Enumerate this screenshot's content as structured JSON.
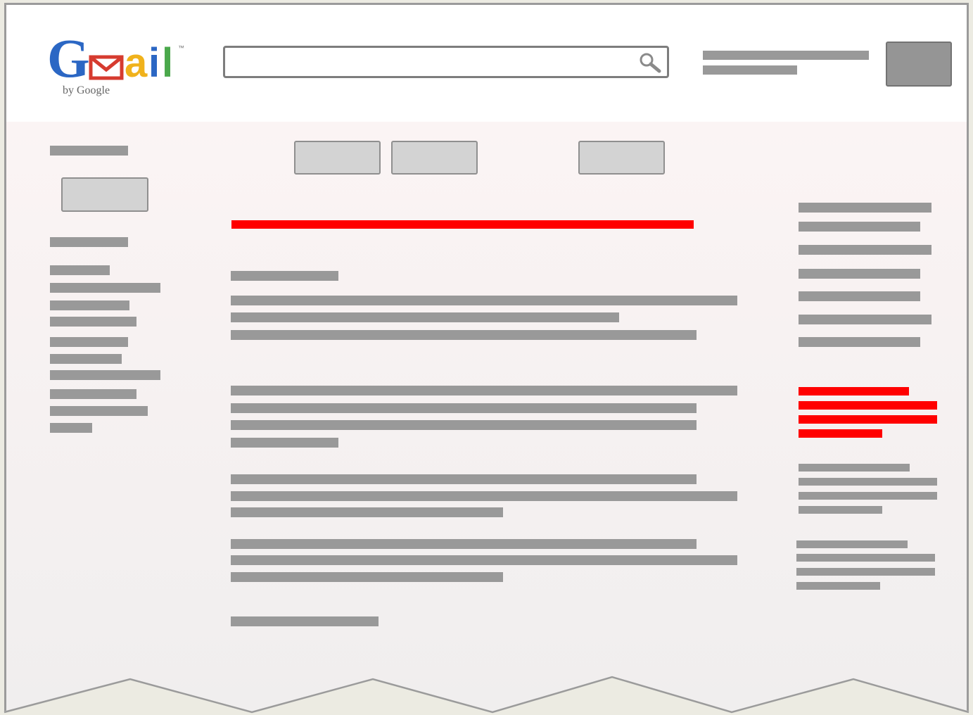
{
  "app": {
    "logo_label": "Gmail",
    "logo_sub": "by Google",
    "logo_tm": "™"
  },
  "colors": {
    "placeholder_bar": "#999999",
    "highlight_bar": "#ff0000",
    "button_fill": "#d3d3d3",
    "header_bg": "#ffffff"
  },
  "icons": {
    "search": "search-icon"
  }
}
